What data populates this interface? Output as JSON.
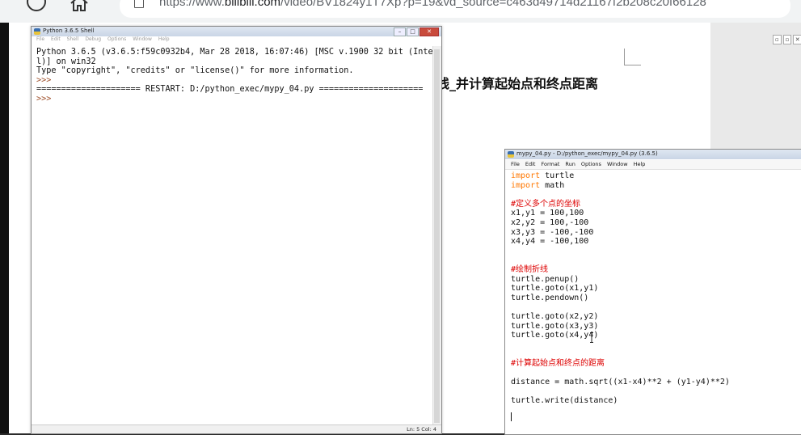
{
  "browser": {
    "url_prefix": "https://www.",
    "url_domain": "bilibili.com",
    "url_rest": "/video/BV1824y1T7Xp?p=19&vd_source=c463d49714d21167f2b208c20f66128"
  },
  "doc": {
    "heading": "线_并计算起始点和终点距离"
  },
  "shell": {
    "title": "Python 3.6.5 Shell",
    "menu": [
      "File",
      "Edit",
      "Shell",
      "Debug",
      "Options",
      "Window",
      "Help"
    ],
    "lines": [
      "Python 3.6.5 (v3.6.5:f59c0932b4, Mar 28 2018, 16:07:46) [MSC v.1900 32 bit (Inte",
      "l)] on win32",
      "Type \"copyright\", \"credits\" or \"license()\" for more information.",
      ">>> ",
      "===================== RESTART: D:/python_exec/mypy_04.py =====================",
      ">>> "
    ],
    "status": "Ln: 5  Col: 4"
  },
  "editor": {
    "title": "mypy_04.py - D:/python_exec/mypy_04.py (3.6.5)",
    "menu": [
      "File",
      "Edit",
      "Format",
      "Run",
      "Options",
      "Window",
      "Help"
    ],
    "code": [
      {
        "kw": "import",
        "text": " turtle"
      },
      {
        "kw": "import",
        "text": " math"
      },
      {
        "text": ""
      },
      {
        "cm": "#定义多个点的坐标"
      },
      {
        "text": "x1,y1 = 100,100"
      },
      {
        "text": "x2,y2 = 100,-100"
      },
      {
        "text": "x3,y3 = -100,-100"
      },
      {
        "text": "x4,y4 = -100,100"
      },
      {
        "text": ""
      },
      {
        "text": ""
      },
      {
        "cm": "#绘制折线"
      },
      {
        "text": "turtle.penup()"
      },
      {
        "text": "turtle.goto(x1,y1)"
      },
      {
        "text": "turtle.pendown()"
      },
      {
        "text": ""
      },
      {
        "text": "turtle.goto(x2,y2)"
      },
      {
        "text": "turtle.goto(x3,y3)"
      },
      {
        "text": "turtle.goto(x4,y4)"
      },
      {
        "text": ""
      },
      {
        "text": ""
      },
      {
        "cm": "#计算起始点和终点的距离"
      },
      {
        "text": ""
      },
      {
        "text": "distance = math.sqrt((x1-x4)**2 + (y1-y4)**2)"
      },
      {
        "text": ""
      },
      {
        "text": "turtle.write(distance)"
      }
    ]
  },
  "icons": {
    "back": "circle-nav-icon",
    "home": "home-icon",
    "page": "page-icon"
  }
}
